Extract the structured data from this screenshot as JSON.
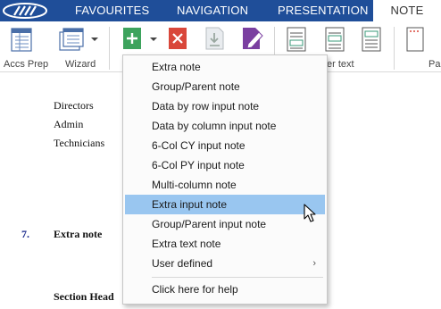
{
  "tabs": [
    {
      "label": "FAVOURITES"
    },
    {
      "label": "NAVIGATION"
    },
    {
      "label": "PRESENTATION"
    },
    {
      "label": "NOTE"
    }
  ],
  "ribbon": {
    "accs_prep_label": "Accs Prep",
    "wizard_label": "Wizard",
    "text_label_partial": "er text",
    "page_label_partial": "Pa"
  },
  "document": {
    "lines": [
      "Directors",
      "Admin",
      "Technicians"
    ],
    "note_number": "7.",
    "note_title": "Extra note",
    "section_header_partial": "Section Head"
  },
  "menu": {
    "items": [
      {
        "label": "Extra note"
      },
      {
        "label": "Group/Parent note"
      },
      {
        "label": "Data by row input note"
      },
      {
        "label": "Data by column input note"
      },
      {
        "label": "6-Col CY input note"
      },
      {
        "label": "6-Col PY input note"
      },
      {
        "label": "Multi-column note"
      },
      {
        "label": "Extra input note"
      },
      {
        "label": "Group/Parent input note"
      },
      {
        "label": "Extra text note"
      },
      {
        "label": "User defined"
      }
    ],
    "submenu_arrow": "›",
    "help_label": "Click here for help",
    "highlighted_item": "Extra input note"
  },
  "colors": {
    "tabbar": "#1f4e99",
    "highlight": "#99c6f0",
    "add_green": "#3da35d",
    "delete_red": "#d9473a",
    "edit_purple": "#7a3fa0",
    "doc_blue": "#1a2a8c"
  }
}
